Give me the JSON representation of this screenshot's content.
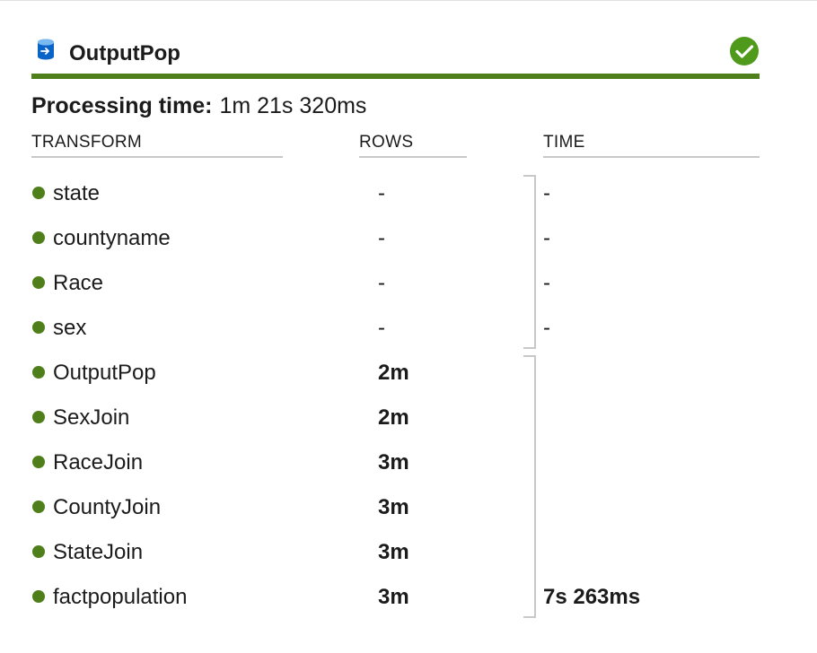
{
  "header": {
    "title": "OutputPop",
    "icon": "database-sink-icon",
    "status_icon": "success-check-icon",
    "accent_color": "#4f7f1a"
  },
  "processing": {
    "label": "Processing time:",
    "value": "1m 21s 320ms"
  },
  "columns": {
    "transform": "TRANSFORM",
    "rows": "ROWS",
    "time": "TIME"
  },
  "transforms": [
    {
      "name": "state",
      "rows": "-",
      "time": "-"
    },
    {
      "name": "countyname",
      "rows": "-",
      "time": "-"
    },
    {
      "name": "Race",
      "rows": "-",
      "time": "-"
    },
    {
      "name": "sex",
      "rows": "-",
      "time": "-"
    },
    {
      "name": "OutputPop",
      "rows": "2m",
      "time": ""
    },
    {
      "name": "SexJoin",
      "rows": "2m",
      "time": ""
    },
    {
      "name": "RaceJoin",
      "rows": "3m",
      "time": ""
    },
    {
      "name": "CountyJoin",
      "rows": "3m",
      "time": ""
    },
    {
      "name": "StateJoin",
      "rows": "3m",
      "time": ""
    },
    {
      "name": "factpopulation",
      "rows": "3m",
      "time": "7s 263ms"
    }
  ]
}
